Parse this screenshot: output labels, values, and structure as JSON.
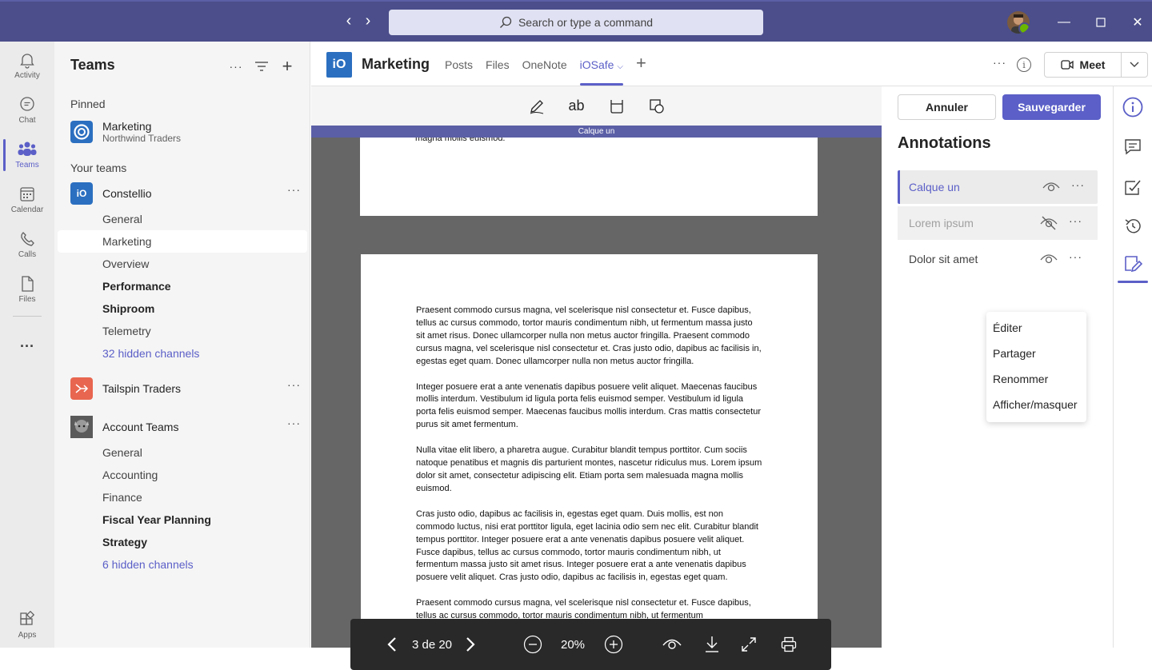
{
  "search": {
    "placeholder": "Search or type a command"
  },
  "rail": [
    {
      "label": "Activity",
      "icon": "bell-icon"
    },
    {
      "label": "Chat",
      "icon": "chat-icon"
    },
    {
      "label": "Teams",
      "icon": "teams-icon",
      "active": true
    },
    {
      "label": "Calendar",
      "icon": "calendar-icon"
    },
    {
      "label": "Calls",
      "icon": "phone-icon"
    },
    {
      "label": "Files",
      "icon": "file-icon"
    },
    {
      "label": "...",
      "icon": "more-icon"
    },
    {
      "label": "Apps",
      "icon": "apps-icon"
    }
  ],
  "teams": {
    "title": "Teams",
    "pinned_label": "Pinned",
    "pinned": {
      "name": "Marketing",
      "sub": "Northwind Traders"
    },
    "your_teams_label": "Your teams",
    "constellio": {
      "name": "Constellio",
      "channels": [
        "General",
        "Marketing",
        "Overview",
        "Performance",
        "Shiproom",
        "Telemetry"
      ],
      "hidden": "32 hidden channels"
    },
    "tailspin": {
      "name": "Tailspin Traders"
    },
    "account": {
      "name": "Account Teams",
      "channels": [
        "General",
        "Accounting",
        "Finance",
        "Fiscal Year Planning",
        "Strategy"
      ],
      "hidden": "6 hidden channels"
    }
  },
  "header": {
    "logo": "iO",
    "title": "Marketing",
    "tabs": [
      "Posts",
      "Files",
      "OneNote",
      "iOSafe"
    ],
    "active_tab": "iOSafe",
    "meet_label": "Meet"
  },
  "viewer": {
    "layer_banner": "Calque un",
    "top_fragment": "magna mollis euismod.",
    "paragraphs": [
      "Praesent commodo cursus magna, vel scelerisque nisl consectetur et. Fusce dapibus, tellus ac cursus commodo, tortor mauris condimentum nibh, ut fermentum massa justo sit amet risus. Donec ullamcorper nulla non metus auctor fringilla. Praesent commodo cursus magna, vel scelerisque nisl consectetur et. Cras justo odio, dapibus ac facilisis in, egestas eget quam. Donec ullamcorper nulla non metus auctor fringilla.",
      "Integer posuere erat a ante venenatis dapibus posuere velit aliquet. Maecenas faucibus mollis interdum. Vestibulum id ligula porta felis euismod semper. Vestibulum id ligula porta felis euismod semper. Maecenas faucibus mollis interdum. Cras mattis consectetur purus sit amet fermentum.",
      "Nulla vitae elit libero, a pharetra augue. Curabitur blandit tempus porttitor. Cum sociis natoque penatibus et magnis dis parturient montes, nascetur ridiculus mus. Lorem ipsum dolor sit amet, consectetur adipiscing elit. Etiam porta sem malesuada magna mollis euismod.",
      "Cras justo odio, dapibus ac facilisis in, egestas eget quam. Duis mollis, est non commodo luctus, nisi erat porttitor ligula, eget lacinia odio sem nec elit. Curabitur blandit tempus porttitor. Integer posuere erat a ante venenatis dapibus posuere velit aliquet. Fusce dapibus, tellus ac cursus commodo, tortor mauris condimentum nibh, ut fermentum massa justo sit amet risus. Integer posuere erat a ante venenatis dapibus posuere velit aliquet. Cras justo odio, dapibus ac facilisis in, egestas eget quam.",
      "Praesent commodo cursus magna, vel scelerisque nisl consectetur et. Fusce dapibus, tellus ac cursus commodo, tortor mauris condimentum nibh, ut fermentum"
    ],
    "page_indicator": "3 de 20",
    "zoom": "20%"
  },
  "annotations": {
    "cancel_label": "Annuler",
    "save_label": "Sauvegarder",
    "title": "Annotations",
    "layers": [
      {
        "name": "Calque un",
        "visible": true,
        "selected": true
      },
      {
        "name": "Lorem ipsum",
        "visible": false
      },
      {
        "name": "Dolor sit amet",
        "visible": true
      }
    ],
    "menu": [
      "Éditer",
      "Partager",
      "Renommer",
      "Afficher/masquer"
    ]
  },
  "colors": {
    "brand": "#5b5fc7",
    "titlebar": "#4b4e8a",
    "app_logo": "#2b6fc0",
    "tailspin": "#e8664f"
  }
}
